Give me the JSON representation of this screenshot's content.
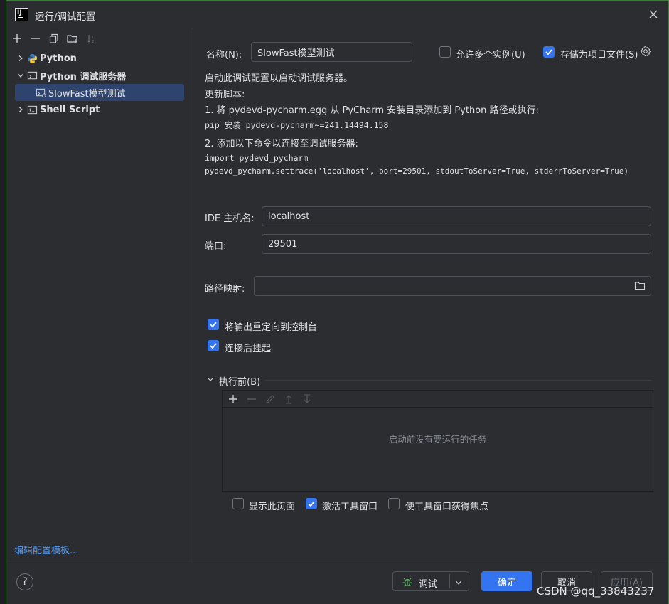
{
  "window": {
    "title": "运行/调试配置",
    "logo_text": "IJ"
  },
  "tree": {
    "items": [
      {
        "label": "Python"
      },
      {
        "label": "Python 调试服务器"
      },
      {
        "label": "SlowFast模型测试"
      },
      {
        "label": "Shell Script"
      }
    ],
    "edit_templates": "编辑配置模板..."
  },
  "form": {
    "name_label": "名称(N):",
    "name_value": "SlowFast模型测试",
    "allow_parallel": {
      "label": "允许多个实例(U)",
      "checked": false
    },
    "store_project": {
      "label": "存储为项目文件(S)",
      "checked": true
    },
    "info": {
      "line1": "启动此调试配置以启动调试服务器。",
      "line2": "更新脚本:",
      "line3": "1. 将 pydevd-pycharm.egg 从 PyCharm 安装目录添加到 Python 路径或执行:",
      "code1": "pip 安装 pydevd-pycharm~=241.14494.158",
      "line4": "2. 添加以下命令以连接至调试服务器:",
      "code2": "import pydevd_pycharm",
      "code3": "pydevd_pycharm.settrace('localhost', port=29501, stdoutToServer=True, stderrToServer=True)"
    },
    "host_label": "IDE 主机名:",
    "host_value": "localhost",
    "port_label": "端口:",
    "port_value": "29501",
    "path_label": "路径映射:",
    "path_value": "",
    "redirect_output": {
      "label": "将输出重定向到控制台",
      "checked": true
    },
    "suspend_after": {
      "label": "连接后挂起",
      "checked": true
    }
  },
  "before_launch": {
    "title": "执行前(B)",
    "empty_text": "启动前没有要运行的任务",
    "show_page": {
      "label": "显示此页面",
      "checked": false
    },
    "activate_tool": {
      "label": "激活工具窗口",
      "checked": true
    },
    "focus_tool": {
      "label": "使工具窗口获得焦点",
      "checked": false
    }
  },
  "buttons": {
    "help": "?",
    "debug": "调试",
    "ok": "确定",
    "cancel": "取消",
    "apply": "应用(A)"
  },
  "watermark": "CSDN @qq_33843237",
  "colors": {
    "accent": "#3574f0",
    "selection": "#2e436e",
    "link": "#589df6"
  }
}
